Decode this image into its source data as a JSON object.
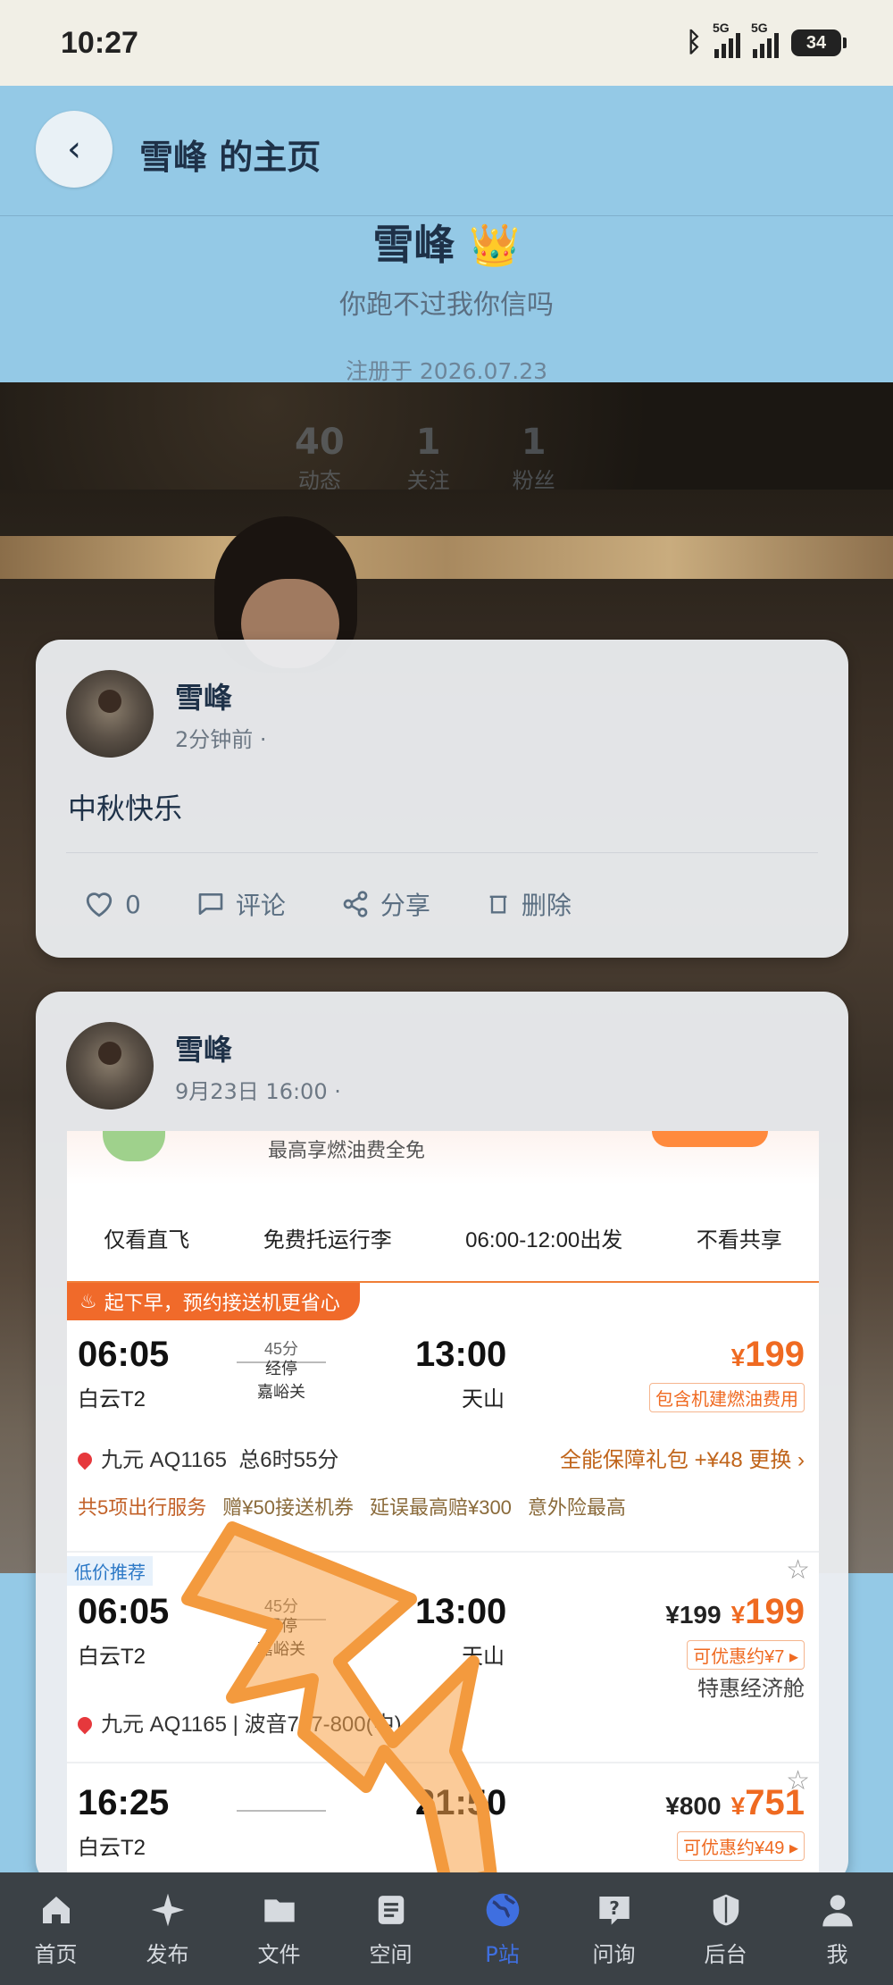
{
  "status_bar": {
    "time": "10:27",
    "net1": "5G",
    "net2": "5G",
    "battery": "34"
  },
  "header": {
    "back_icon": "chevron-left-icon",
    "title": "雪峰 的主页"
  },
  "profile": {
    "name": "雪峰",
    "badge": "👑",
    "signature": "你跑不过我你信吗",
    "registered": "注册于 2026.07.23",
    "stats": [
      {
        "num": "40",
        "label": "动态"
      },
      {
        "num": "1",
        "label": "关注"
      },
      {
        "num": "1",
        "label": "粉丝"
      }
    ]
  },
  "posts": [
    {
      "user": "雪峰",
      "time": "2分钟前 ·",
      "content": "中秋快乐",
      "actions": {
        "likes": "0",
        "comment": "评论",
        "share": "分享",
        "delete": "删除"
      }
    },
    {
      "user": "雪峰",
      "time": "9月23日 16:00 ·"
    }
  ],
  "embedded_screenshot": {
    "banner": "最高享燃油费全免",
    "filters": [
      "仅看直飞",
      "免费托运行李",
      "06:00-12:00出发",
      "不看共享"
    ],
    "promo_tag": "起下早，预约接送机更省心",
    "flight1": {
      "dep_time": "06:05",
      "dep_apt": "白云T2",
      "duration": "45分",
      "stop": "经停",
      "stop_city": "嘉峪关",
      "arr_time": "13:00",
      "arr_apt": "天山",
      "price_prefix": "¥",
      "price": "199",
      "price_note": "包含机建燃油费用",
      "airline": "九元 AQ1165",
      "total": "总6时55分",
      "guard": "全能保障礼包 +¥48 更换 ›",
      "services": "共5项出行服务",
      "svc1": "赠¥50接送机券",
      "svc2": "延误最高赔¥300",
      "svc3": "意外险最高"
    },
    "low_tag": "低价推荐",
    "flight2": {
      "dep_time": "06:05",
      "dep_apt": "白云T2",
      "duration": "45分",
      "stop": "经停",
      "stop_city": "嘉峪关",
      "arr_time": "13:00",
      "arr_apt": "天山",
      "old_price": "¥199",
      "price_prefix": "¥",
      "price": "199",
      "discount": "可优惠约¥7 ▸",
      "cabin": "特惠经济舱",
      "airline": "九元 AQ1165",
      "plane": "波音737-800(中)"
    },
    "flight3": {
      "dep_time": "16:25",
      "dep_apt": "白云T2",
      "arr_time": "21:50",
      "old_price": "¥800",
      "price_prefix": "¥",
      "price": "751",
      "discount": "可优惠约¥49 ▸"
    }
  },
  "tabbar": [
    {
      "label": "首页",
      "icon": "home-icon"
    },
    {
      "label": "发布",
      "icon": "sparkle-icon"
    },
    {
      "label": "文件",
      "icon": "folder-icon"
    },
    {
      "label": "空间",
      "icon": "document-icon"
    },
    {
      "label": "P站",
      "icon": "globe-icon",
      "active": true
    },
    {
      "label": "问询",
      "icon": "question-bubble-icon"
    },
    {
      "label": "后台",
      "icon": "shield-icon"
    },
    {
      "label": "我",
      "icon": "person-icon"
    }
  ],
  "colors": {
    "accent": "#3f6fe0",
    "header_bg": "#94c9e6",
    "price": "#ef6a21"
  }
}
